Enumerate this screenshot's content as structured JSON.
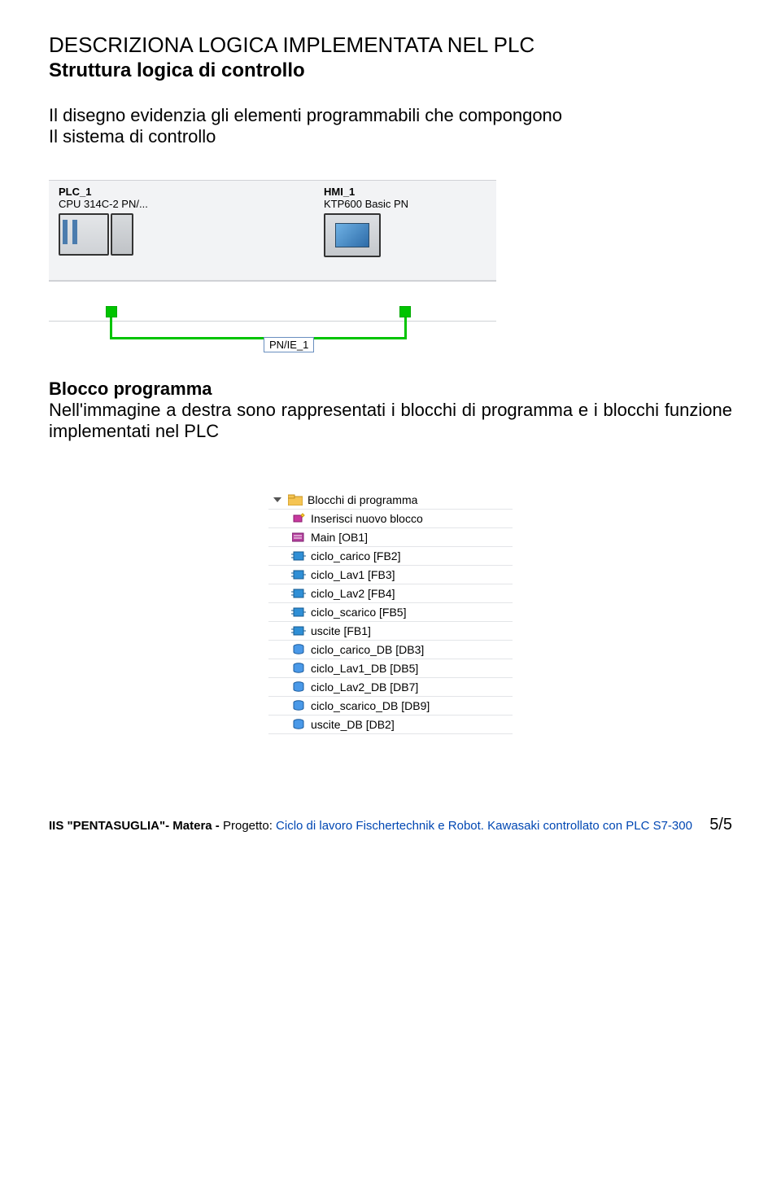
{
  "title_main": "DESCRIZIONA LOGICA IMPLEMENTATA NEL PLC",
  "title_sub": "Struttura logica di controllo",
  "intro_line1": "Il disegno evidenzia gli elementi programmabili che compongono",
  "intro_line2": "Il sistema di controllo",
  "diagram": {
    "plc": {
      "name": "PLC_1",
      "type": "CPU 314C-2 PN/..."
    },
    "hmi": {
      "name": "HMI_1",
      "type": "KTP600 Basic PN"
    },
    "net_label": "PN/IE_1"
  },
  "section2": {
    "title": "Blocco programma",
    "text": "Nell'immagine a destra sono rappresentati i blocchi di programma e i blocchi funzione implementati nel PLC"
  },
  "tree": {
    "root": "Blocchi di programma",
    "items": [
      {
        "kind": "new",
        "label": "Inserisci nuovo blocco"
      },
      {
        "kind": "ob",
        "label": "Main [OB1]"
      },
      {
        "kind": "fb",
        "label": "ciclo_carico [FB2]"
      },
      {
        "kind": "fb",
        "label": "ciclo_Lav1 [FB3]"
      },
      {
        "kind": "fb",
        "label": "ciclo_Lav2 [FB4]"
      },
      {
        "kind": "fb",
        "label": "ciclo_scarico [FB5]"
      },
      {
        "kind": "fb",
        "label": "uscite [FB1]"
      },
      {
        "kind": "db",
        "label": "ciclo_carico_DB [DB3]"
      },
      {
        "kind": "db",
        "label": "ciclo_Lav1_DB [DB5]"
      },
      {
        "kind": "db",
        "label": "ciclo_Lav2_DB [DB7]"
      },
      {
        "kind": "db",
        "label": "ciclo_scarico_DB [DB9]"
      },
      {
        "kind": "db",
        "label": "uscite_DB [DB2]"
      }
    ]
  },
  "footer": {
    "org": "IIS \"PENTASUGLIA\"- Matera - ",
    "proj_label": "Progetto:  ",
    "proj_text": "Ciclo di lavoro Fischertechnik e Robot. Kawasaki controllato con PLC S7-300",
    "page": "5/5"
  }
}
